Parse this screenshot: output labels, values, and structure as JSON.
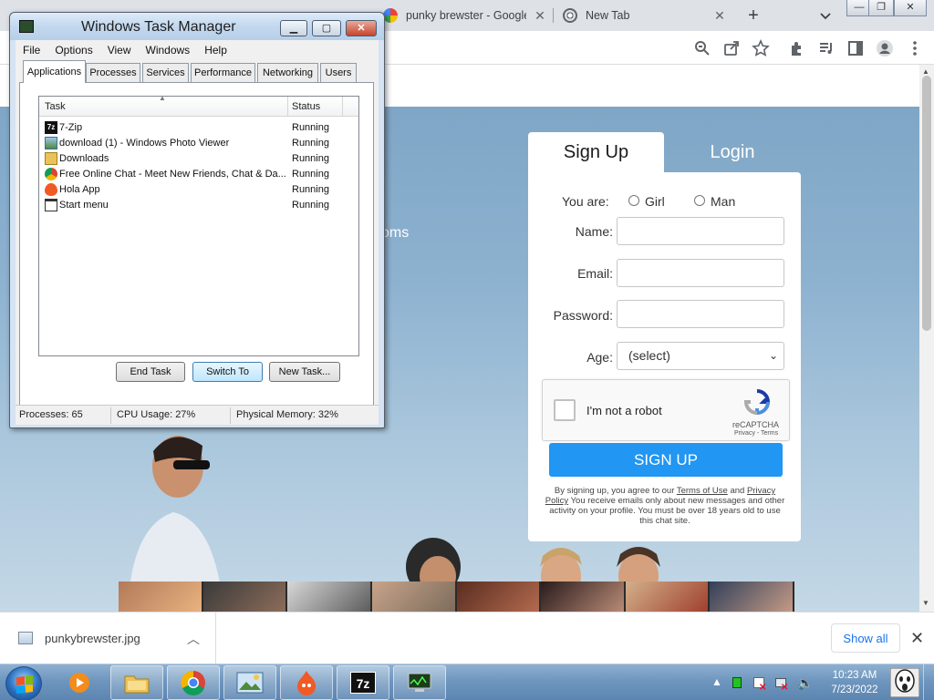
{
  "browser": {
    "tabs": [
      {
        "title": "punky brewster - Google"
      },
      {
        "title": "New Tab"
      }
    ],
    "new_tab_symbol": "+",
    "toolbar_icons": [
      "zoom-icon",
      "share-icon",
      "star-icon",
      "extensions-icon",
      "media-icon",
      "sidebar-icon",
      "profile-icon",
      "menu-icon"
    ]
  },
  "page": {
    "hero_fragment": "oms",
    "signup": {
      "tab_signup": "Sign Up",
      "tab_login": "Login",
      "you_are_label": "You are:",
      "gender_options": [
        "Girl",
        "Man"
      ],
      "name_label": "Name:",
      "email_label": "Email:",
      "password_label": "Password:",
      "age_label": "Age:",
      "age_value": "(select)",
      "recaptcha_text": "I'm not a robot",
      "recaptcha_brand": "reCAPTCHA",
      "recaptcha_terms": "Privacy - Terms",
      "button": "SIGN UP",
      "legal_prefix": "By signing up, you agree to our ",
      "legal_terms": "Terms of Use",
      "legal_and": " and ",
      "legal_privacy": "Privacy Policy",
      "legal_suffix": " You receive emails only about new messages and other activity on your profile. You must be over 18 years old to use this chat site."
    },
    "accent": "#2196f3"
  },
  "downloads": {
    "file": "punkybrewster.jpg",
    "show_all": "Show all"
  },
  "task_manager": {
    "title": "Windows Task Manager",
    "menu": [
      "File",
      "Options",
      "View",
      "Windows",
      "Help"
    ],
    "tabs": [
      "Applications",
      "Processes",
      "Services",
      "Performance",
      "Networking",
      "Users"
    ],
    "columns": {
      "task": "Task",
      "status": "Status"
    },
    "rows": [
      {
        "name": "7-Zip",
        "status": "Running",
        "icon": "7zip-icon"
      },
      {
        "name": "download (1) - Windows Photo Viewer",
        "status": "Running",
        "icon": "photo-viewer-icon"
      },
      {
        "name": "Downloads",
        "status": "Running",
        "icon": "folder-icon"
      },
      {
        "name": "Free Online Chat - Meet New Friends, Chat & Da...",
        "status": "Running",
        "icon": "chrome-icon"
      },
      {
        "name": "Hola App",
        "status": "Running",
        "icon": "hola-icon"
      },
      {
        "name": "Start menu",
        "status": "Running",
        "icon": "window-icon"
      }
    ],
    "buttons": {
      "end_task": "End Task",
      "switch_to": "Switch To",
      "new_task": "New Task..."
    },
    "status": {
      "processes": "Processes: 65",
      "cpu": "CPU Usage: 27%",
      "memory": "Physical Memory: 32%"
    }
  },
  "taskbar": {
    "apps": [
      "media-player-icon",
      "explorer-icon",
      "chrome-icon",
      "photo-viewer-icon",
      "hola-icon",
      "7zip-icon",
      "task-manager-icon"
    ],
    "clock_time": "10:23 AM",
    "clock_date": "7/23/2022"
  }
}
